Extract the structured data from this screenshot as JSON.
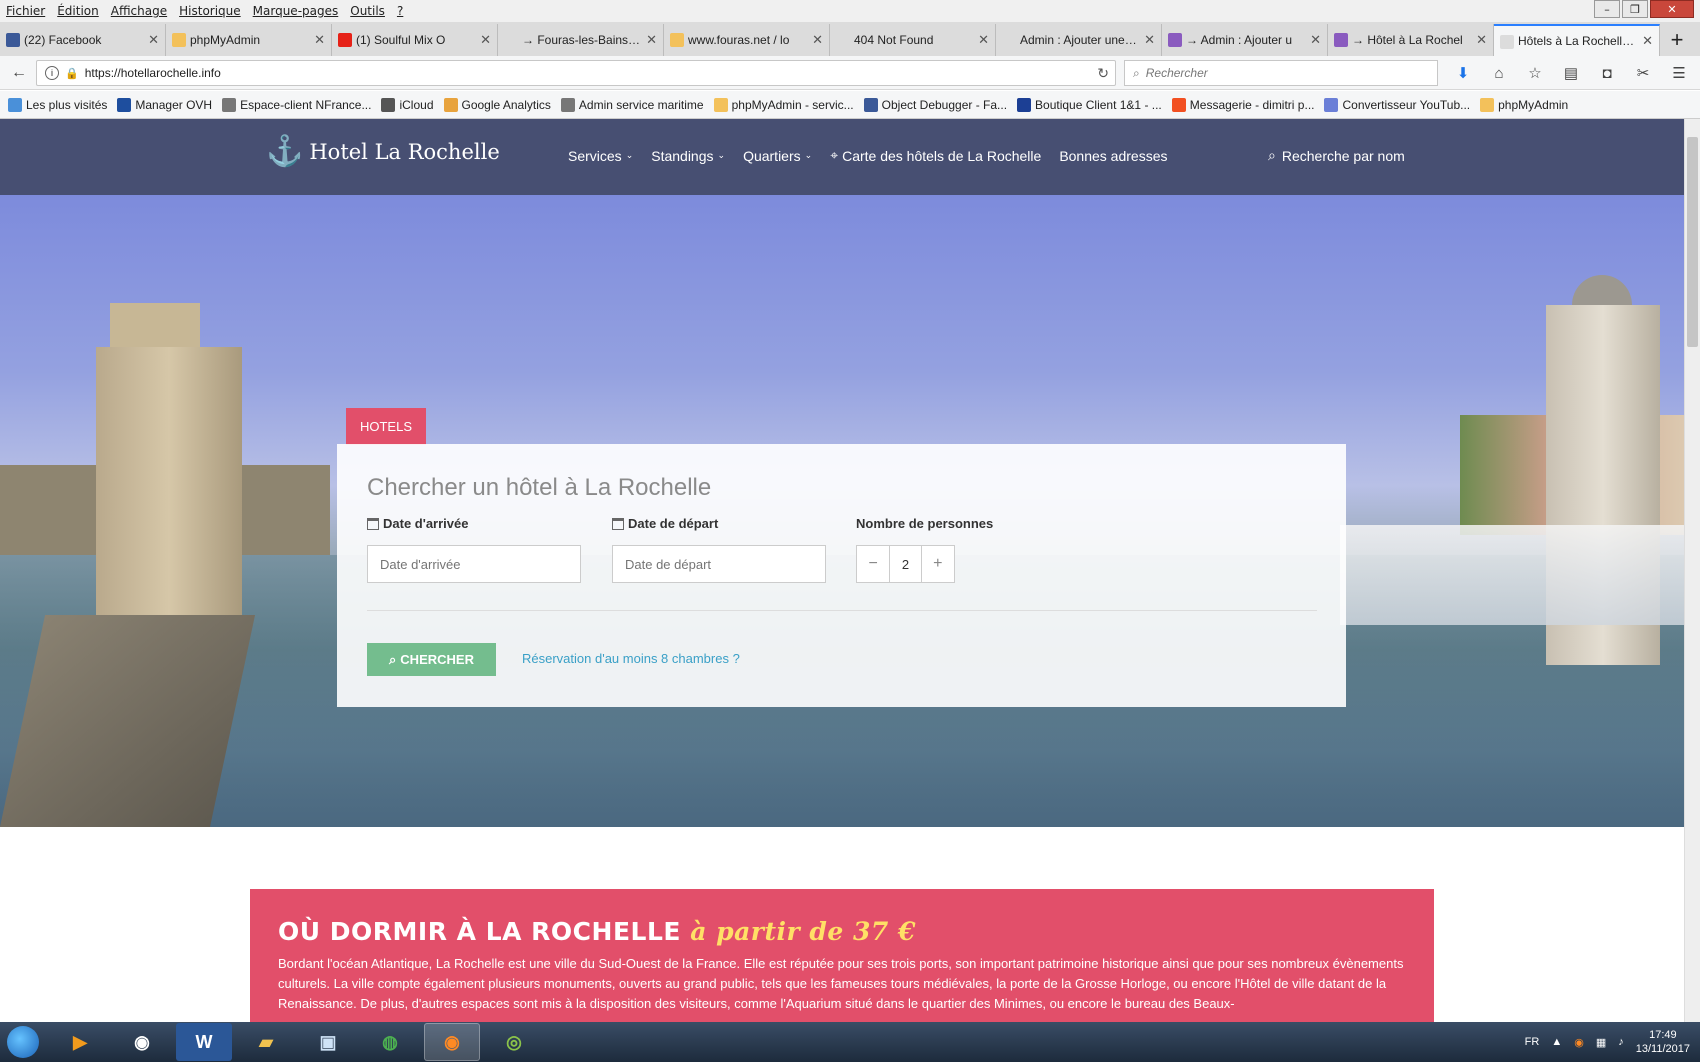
{
  "menu": [
    "Fichier",
    "Édition",
    "Affichage",
    "Historique",
    "Marque-pages",
    "Outils",
    "?"
  ],
  "tabs": [
    {
      "label": "(22) Facebook",
      "color": "#3b5998"
    },
    {
      "label": "phpMyAdmin",
      "color": "#f3c15b"
    },
    {
      "label": "(1) Soulful Mix O",
      "color": "#e62117"
    },
    {
      "label": "→ Fouras-les-Bains en i",
      "color": "#dcdcdc"
    },
    {
      "label": "www.fouras.net / lo",
      "color": "#f3c15b"
    },
    {
      "label": "404 Not Found",
      "color": "#dcdcdc"
    },
    {
      "label": "Admin : Ajouter une gal",
      "color": "#dcdcdc"
    },
    {
      "label": "→ Admin : Ajouter u",
      "color": "#8a5bbf"
    },
    {
      "label": "→ Hôtel à La Rochel",
      "color": "#8a5bbf"
    },
    {
      "label": "Hôtels à La Rochelle : in",
      "color": "#dcdcdc"
    }
  ],
  "url": "https://hotellarochelle.info",
  "search_placeholder": "Rechercher",
  "bookmarks": [
    "Les plus visités",
    "Manager OVH",
    "Espace-client NFrance...",
    "iCloud",
    "Google Analytics",
    "Admin service maritime",
    "phpMyAdmin - servic...",
    "Object Debugger - Fa...",
    "Boutique Client 1&1 - ...",
    "Messagerie - dimitri p...",
    "Convertisseur YouTub...",
    "phpMyAdmin"
  ],
  "site": {
    "logo": "Hotel La Rochelle",
    "nav": [
      "Services",
      "Standings",
      "Quartiers"
    ],
    "map_link": "Carte des hôtels de La Rochelle",
    "good_addresses": "Bonnes adresses",
    "name_search": "Recherche par nom"
  },
  "search": {
    "tab": "HOTELS",
    "title": "Chercher un hôtel à La Rochelle",
    "arrival_label": "Date d'arrivée",
    "arrival_placeholder": "Date d'arrivée",
    "departure_label": "Date de départ",
    "departure_placeholder": "Date de départ",
    "people_label": "Nombre de personnes",
    "people_value": "2",
    "minus": "−",
    "plus": "+",
    "button": "CHERCHER",
    "group_link": "Réservation d'au moins 8 chambres ?"
  },
  "promo": {
    "title_main": "OÙ DORMIR À LA ROCHELLE",
    "title_highlight": "à partir de 37 €",
    "text": "Bordant l'océan Atlantique, La Rochelle est une ville du Sud-Ouest de la France. Elle est réputée pour ses trois ports, son important patrimoine historique ainsi que pour ses nombreux évènements culturels. La ville compte également plusieurs monuments, ouverts au grand public, tels que les fameuses tours médiévales, la porte de la Grosse Horloge, ou encore l'Hôtel de ville datant de la Renaissance. De plus, d'autres espaces sont mis à la disposition des visiteurs, comme l'Aquarium situé dans le quartier des Minimes, ou encore le bureau des Beaux-"
  },
  "tray": {
    "lang": "FR",
    "time": "17:49",
    "date": "13/11/2017"
  },
  "colors": {
    "header": "#474f72",
    "accent": "#e24f6a",
    "button": "#74bd8e",
    "link": "#3aa0c7"
  }
}
